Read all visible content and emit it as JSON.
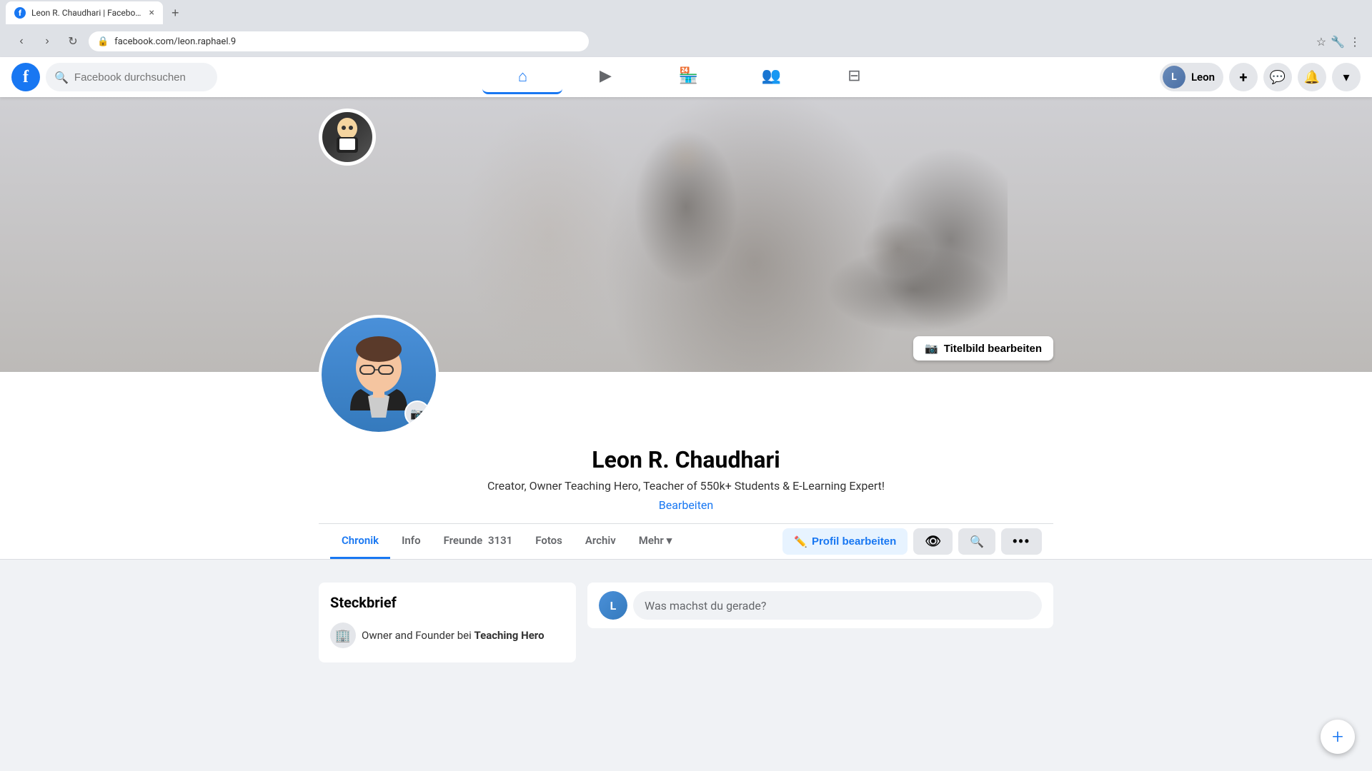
{
  "browser": {
    "tab_title": "Leon R. Chaudhari | Facebook",
    "url": "facebook.com/leon.raphael.9",
    "close_label": "×",
    "new_tab_label": "+"
  },
  "header": {
    "logo_letter": "f",
    "search_placeholder": "Facebook durchsuchen",
    "user_name": "Leon",
    "nav": [
      {
        "id": "home",
        "icon": "⌂",
        "active": false
      },
      {
        "id": "video",
        "icon": "▶",
        "active": false
      },
      {
        "id": "marketplace",
        "icon": "🏪",
        "active": false
      },
      {
        "id": "groups",
        "icon": "👥",
        "active": false
      },
      {
        "id": "gaming",
        "icon": "⊟",
        "active": false
      }
    ],
    "add_button_label": "+",
    "messenger_icon": "💬",
    "notification_icon": "🔔",
    "dropdown_icon": "▾"
  },
  "profile": {
    "name": "Leon R. Chaudhari",
    "bio": "Creator, Owner Teaching Hero, Teacher of 550k+ Students & E-Learning Expert!",
    "edit_bio_label": "Bearbeiten",
    "edit_cover_icon": "📷",
    "edit_cover_label": "Titelbild bearbeiten",
    "avatar_camera_icon": "📷",
    "nav_items": [
      {
        "id": "chronik",
        "label": "Chronik",
        "active": true
      },
      {
        "id": "info",
        "label": "Info",
        "active": false
      },
      {
        "id": "freunde",
        "label": "Freunde",
        "active": false,
        "count": "3131"
      },
      {
        "id": "fotos",
        "label": "Fotos",
        "active": false
      },
      {
        "id": "archiv",
        "label": "Archiv",
        "active": false
      },
      {
        "id": "mehr",
        "label": "Mehr",
        "active": false,
        "has_dropdown": true
      }
    ],
    "action_buttons": [
      {
        "id": "edit-profile",
        "icon": "✏️",
        "label": "Profil bearbeiten",
        "type": "primary"
      },
      {
        "id": "view",
        "icon": "👁",
        "label": "",
        "type": "secondary"
      },
      {
        "id": "search",
        "icon": "🔍",
        "label": "",
        "type": "secondary"
      },
      {
        "id": "more",
        "icon": "•••",
        "label": "",
        "type": "secondary"
      }
    ],
    "steckbrief": {
      "title": "Steckbrief",
      "items": [
        {
          "icon": "🏢",
          "text": "Owner and Founder bei ",
          "bold": "Teaching Hero"
        }
      ]
    },
    "post_placeholder": "Was machst du gerade?"
  },
  "fab": {
    "icon": "+"
  },
  "colors": {
    "facebook_blue": "#1877f2",
    "background": "#f0f2f5",
    "text_primary": "#050505",
    "text_secondary": "#65676b"
  }
}
